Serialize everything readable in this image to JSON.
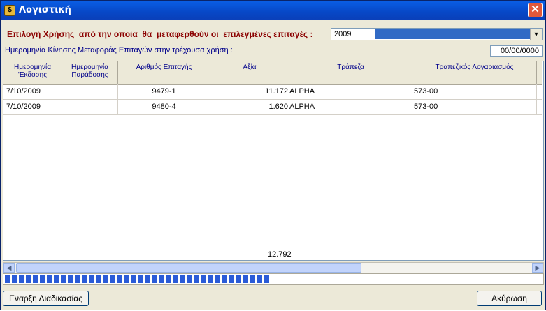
{
  "window": {
    "title": "Λογιστική"
  },
  "selection": {
    "label": "Επιλογή Χρήσης  από την οποία  θα  μεταφερθούν οι  επιλεγμένες επιταγές :",
    "year": "2009"
  },
  "transfer_date": {
    "label": "Ημερομηνία Κίνησης Μεταφοράς Επιταγών στην τρέχουσα χρήση :",
    "value": "00/00/0000"
  },
  "grid": {
    "columns": [
      {
        "line1": "Ημερομηνία",
        "line2": "'Εκδοσης"
      },
      {
        "line1": "Ημερομηνία",
        "line2": "Παράδοσης"
      },
      {
        "line1": "Αριθμός Επιταγής",
        "line2": ""
      },
      {
        "line1": "Αξία",
        "line2": ""
      },
      {
        "line1": "Τράπεζα",
        "line2": ""
      },
      {
        "line1": "Τραπεζικός Λογαριασμός",
        "line2": ""
      }
    ],
    "rows": [
      {
        "issue_date": "7/10/2009",
        "delivery_date": "",
        "check_no": "9479-1",
        "amount": "11.172",
        "bank": "ALPHA",
        "account": "573-00"
      },
      {
        "issue_date": "7/10/2009",
        "delivery_date": "",
        "check_no": "9480-4",
        "amount": "1.620",
        "bank": "ALPHA",
        "account": "573-00"
      }
    ],
    "total": "12.792"
  },
  "progress": {
    "fraction": 0.5
  },
  "buttons": {
    "start": "Εναρξη Διαδικασίας",
    "cancel": "Ακύρωση"
  },
  "colors": {
    "titlebar": "#0747c6",
    "label_red": "#8b0000",
    "label_blue": "#00008b",
    "progress": "#2b5bd7"
  }
}
